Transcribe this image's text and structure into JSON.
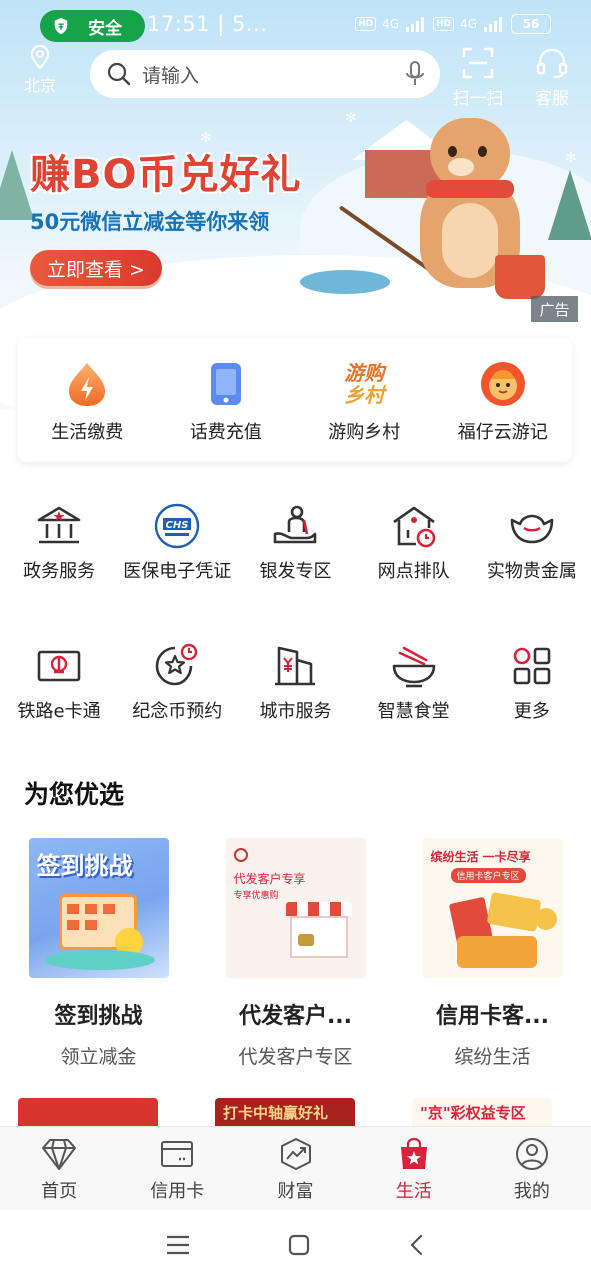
{
  "status_bar": {
    "safe_label": "安全",
    "time": "17:51 | 5...",
    "network_hd": "HD",
    "network_gen": "4G",
    "battery": "56"
  },
  "header": {
    "location": "北京",
    "search_placeholder": "请输入",
    "scan_label": "扫一扫",
    "service_label": "客服"
  },
  "banner": {
    "title": "赚BO币兑好礼",
    "subtitle": "50元微信立减金等你来领",
    "button": "立即查看 >",
    "ad_tag": "广告"
  },
  "quick_actions": [
    {
      "label": "生活缴费",
      "icon": "flame-drop-icon"
    },
    {
      "label": "话费充值",
      "icon": "phone-icon"
    },
    {
      "label": "游购乡村",
      "icon": "village-logo-icon",
      "logo_text_1": "游购",
      "logo_text_2": "乡村"
    },
    {
      "label": "福仔云游记",
      "icon": "mascot-icon"
    }
  ],
  "services_row1": [
    {
      "label": "政务服务",
      "icon": "government-building-icon"
    },
    {
      "label": "医保电子凭证",
      "icon": "chs-badge-icon",
      "badge": "CHS"
    },
    {
      "label": "银发专区",
      "icon": "elder-care-icon"
    },
    {
      "label": "网点排队",
      "icon": "branch-queue-icon"
    },
    {
      "label": "实物贵金属",
      "icon": "gold-ingot-icon"
    }
  ],
  "services_row2": [
    {
      "label": "铁路e卡通",
      "icon": "railway-card-icon"
    },
    {
      "label": "纪念币预约",
      "icon": "commemorative-coin-icon"
    },
    {
      "label": "城市服务",
      "icon": "city-building-icon"
    },
    {
      "label": "智慧食堂",
      "icon": "canteen-bowl-icon"
    },
    {
      "label": "更多",
      "icon": "more-grid-icon"
    }
  ],
  "section_title": "为您优选",
  "featured": [
    {
      "title": "签到挑战",
      "subtitle": "领立减金",
      "image_text": "签到挑战"
    },
    {
      "title": "代发客户...",
      "subtitle": "代发客户专区",
      "image_text": "代发客户专享",
      "image_subtext": "专享优惠购"
    },
    {
      "title": "信用卡客...",
      "subtitle": "缤纷生活",
      "image_text": "缤纷生活 一卡尽享",
      "image_subtext": "信用卡客户专区"
    }
  ],
  "peek_items": [
    {
      "text": ""
    },
    {
      "text": "打卡中轴赢好礼"
    },
    {
      "text": "\"京\"彩权益专区"
    }
  ],
  "bottom_nav": [
    {
      "label": "首页",
      "icon": "diamond-icon",
      "active": false
    },
    {
      "label": "信用卡",
      "icon": "credit-card-icon",
      "active": false
    },
    {
      "label": "财富",
      "icon": "wealth-chart-icon",
      "active": false
    },
    {
      "label": "生活",
      "icon": "shopping-bag-icon",
      "active": true
    },
    {
      "label": "我的",
      "icon": "user-icon",
      "active": false
    }
  ],
  "colors": {
    "brand_red": "#d8223b",
    "safe_green": "#16a34a",
    "promo_red": "#e04233",
    "promo_blue": "#1673b8"
  }
}
